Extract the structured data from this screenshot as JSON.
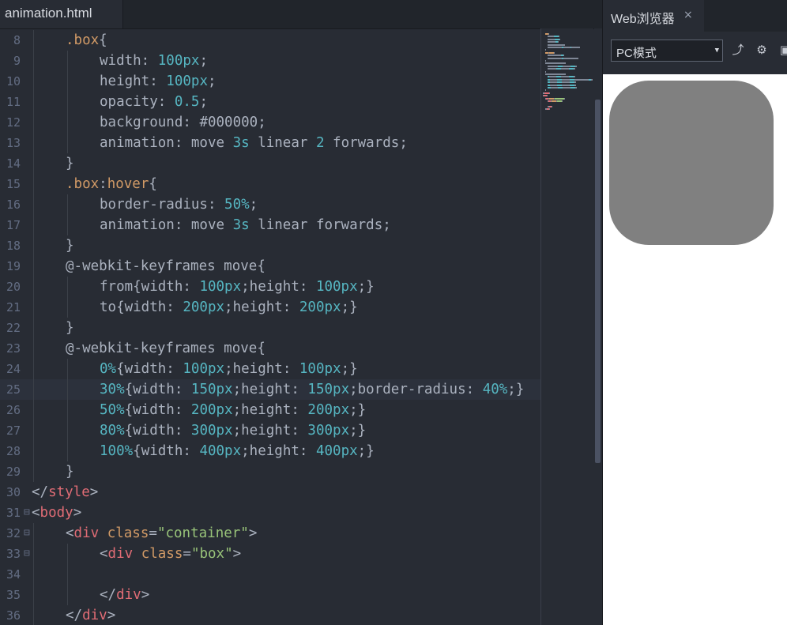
{
  "editor": {
    "tab_label": "animation.html",
    "lines": [
      {
        "n": "8",
        "indent": 1,
        "fold": "",
        "tokens": [
          [
            "sel",
            ".box"
          ],
          [
            "punc",
            "{"
          ]
        ]
      },
      {
        "n": "9",
        "indent": 2,
        "fold": "",
        "tokens": [
          [
            "prop",
            "width: "
          ],
          [
            "num",
            "100px"
          ],
          [
            "punc",
            ";"
          ]
        ]
      },
      {
        "n": "10",
        "indent": 2,
        "fold": "",
        "tokens": [
          [
            "prop",
            "height: "
          ],
          [
            "num",
            "100px"
          ],
          [
            "punc",
            ";"
          ]
        ]
      },
      {
        "n": "11",
        "indent": 2,
        "fold": "",
        "tokens": [
          [
            "prop",
            "opacity: "
          ],
          [
            "num",
            "0.5"
          ],
          [
            "punc",
            ";"
          ]
        ]
      },
      {
        "n": "12",
        "indent": 2,
        "fold": "",
        "tokens": [
          [
            "prop",
            "background: "
          ],
          [
            "prop",
            "#000000"
          ],
          [
            "punc",
            ";"
          ]
        ]
      },
      {
        "n": "13",
        "indent": 2,
        "fold": "",
        "tokens": [
          [
            "prop",
            "animation: move "
          ],
          [
            "num",
            "3s"
          ],
          [
            "prop",
            " linear "
          ],
          [
            "num",
            "2"
          ],
          [
            "prop",
            " forwards;"
          ]
        ]
      },
      {
        "n": "14",
        "indent": 1,
        "fold": "",
        "tokens": [
          [
            "punc",
            "}"
          ]
        ]
      },
      {
        "n": "15",
        "indent": 1,
        "fold": "",
        "tokens": [
          [
            "sel",
            ".box"
          ],
          [
            "punc",
            ":"
          ],
          [
            "sel",
            "hover"
          ],
          [
            "punc",
            "{"
          ]
        ]
      },
      {
        "n": "16",
        "indent": 2,
        "fold": "",
        "tokens": [
          [
            "prop",
            "border-radius: "
          ],
          [
            "num",
            "50%"
          ],
          [
            "punc",
            ";"
          ]
        ]
      },
      {
        "n": "17",
        "indent": 2,
        "fold": "",
        "tokens": [
          [
            "prop",
            "animation: move "
          ],
          [
            "num",
            "3s"
          ],
          [
            "prop",
            " linear forwards;"
          ]
        ]
      },
      {
        "n": "18",
        "indent": 1,
        "fold": "",
        "tokens": [
          [
            "punc",
            "}"
          ]
        ]
      },
      {
        "n": "19",
        "indent": 1,
        "fold": "",
        "tokens": [
          [
            "prop",
            "@-webkit-keyframes move{"
          ]
        ]
      },
      {
        "n": "20",
        "indent": 2,
        "fold": "",
        "tokens": [
          [
            "prop",
            "from{width: "
          ],
          [
            "num",
            "100px"
          ],
          [
            "prop",
            ";height: "
          ],
          [
            "num",
            "100px"
          ],
          [
            "prop",
            ";}"
          ]
        ]
      },
      {
        "n": "21",
        "indent": 2,
        "fold": "",
        "tokens": [
          [
            "prop",
            "to{width: "
          ],
          [
            "num",
            "200px"
          ],
          [
            "prop",
            ";height: "
          ],
          [
            "num",
            "200px"
          ],
          [
            "prop",
            ";}"
          ]
        ]
      },
      {
        "n": "22",
        "indent": 1,
        "fold": "",
        "tokens": [
          [
            "punc",
            "}"
          ]
        ]
      },
      {
        "n": "23",
        "indent": 1,
        "fold": "",
        "tokens": [
          [
            "prop",
            "@-webkit-keyframes move{"
          ]
        ]
      },
      {
        "n": "24",
        "indent": 2,
        "fold": "",
        "tokens": [
          [
            "num",
            "0%"
          ],
          [
            "prop",
            "{width: "
          ],
          [
            "num",
            "100px"
          ],
          [
            "prop",
            ";height: "
          ],
          [
            "num",
            "100px"
          ],
          [
            "prop",
            ";}"
          ]
        ]
      },
      {
        "n": "25",
        "indent": 2,
        "fold": "",
        "current": true,
        "tokens": [
          [
            "num",
            "30%"
          ],
          [
            "prop",
            "{width: "
          ],
          [
            "num",
            "150px"
          ],
          [
            "prop",
            ";height: "
          ],
          [
            "num",
            "150px"
          ],
          [
            "prop",
            ";border-radius: "
          ],
          [
            "num",
            "40%"
          ],
          [
            "prop",
            ";}"
          ]
        ]
      },
      {
        "n": "26",
        "indent": 2,
        "fold": "",
        "tokens": [
          [
            "num",
            "50%"
          ],
          [
            "prop",
            "{width: "
          ],
          [
            "num",
            "200px"
          ],
          [
            "prop",
            ";height: "
          ],
          [
            "num",
            "200px"
          ],
          [
            "prop",
            ";}"
          ]
        ]
      },
      {
        "n": "27",
        "indent": 2,
        "fold": "",
        "tokens": [
          [
            "num",
            "80%"
          ],
          [
            "prop",
            "{width: "
          ],
          [
            "num",
            "300px"
          ],
          [
            "prop",
            ";height: "
          ],
          [
            "num",
            "300px"
          ],
          [
            "prop",
            ";}"
          ]
        ]
      },
      {
        "n": "28",
        "indent": 2,
        "fold": "",
        "tokens": [
          [
            "num",
            "100%"
          ],
          [
            "prop",
            "{width: "
          ],
          [
            "num",
            "400px"
          ],
          [
            "prop",
            ";height: "
          ],
          [
            "num",
            "400px"
          ],
          [
            "prop",
            ";}"
          ]
        ]
      },
      {
        "n": "29",
        "indent": 1,
        "fold": "",
        "tokens": [
          [
            "punc",
            "}"
          ]
        ]
      },
      {
        "n": "30",
        "indent": 0,
        "fold": "",
        "tokens": [
          [
            "punc",
            "</"
          ],
          [
            "tag",
            "style"
          ],
          [
            "punc",
            ">"
          ]
        ]
      },
      {
        "n": "31",
        "indent": 0,
        "fold": "⊟",
        "tokens": [
          [
            "punc",
            "<"
          ],
          [
            "tag",
            "body"
          ],
          [
            "punc",
            ">"
          ]
        ]
      },
      {
        "n": "32",
        "indent": 1,
        "fold": "⊟",
        "tokens": [
          [
            "punc",
            "<"
          ],
          [
            "tag",
            "div"
          ],
          [
            "prop",
            " "
          ],
          [
            "attr",
            "class"
          ],
          [
            "punc",
            "="
          ],
          [
            "str",
            "\"container\""
          ],
          [
            "punc",
            ">"
          ]
        ]
      },
      {
        "n": "33",
        "indent": 2,
        "fold": "⊟",
        "tokens": [
          [
            "punc",
            "<"
          ],
          [
            "tag",
            "div"
          ],
          [
            "prop",
            " "
          ],
          [
            "attr",
            "class"
          ],
          [
            "punc",
            "="
          ],
          [
            "str",
            "\"box\""
          ],
          [
            "punc",
            ">"
          ]
        ]
      },
      {
        "n": "34",
        "indent": 2,
        "fold": "",
        "tokens": []
      },
      {
        "n": "35",
        "indent": 2,
        "fold": "",
        "tokens": [
          [
            "punc",
            "</"
          ],
          [
            "tag",
            "div"
          ],
          [
            "punc",
            ">"
          ]
        ]
      },
      {
        "n": "36",
        "indent": 1,
        "fold": "",
        "tokens": [
          [
            "punc",
            "</"
          ],
          [
            "tag",
            "div"
          ],
          [
            "punc",
            ">"
          ]
        ]
      }
    ]
  },
  "browser": {
    "tab_title": "Web浏览器",
    "close_icon": "×",
    "mode_value": "PC模式",
    "icons": [
      {
        "name": "open-external-icon",
        "glyph": "⤴"
      },
      {
        "name": "gear-icon",
        "glyph": "⚙"
      },
      {
        "name": "devtools-icon",
        "glyph": "▣"
      }
    ],
    "preview_color": "#808080"
  }
}
